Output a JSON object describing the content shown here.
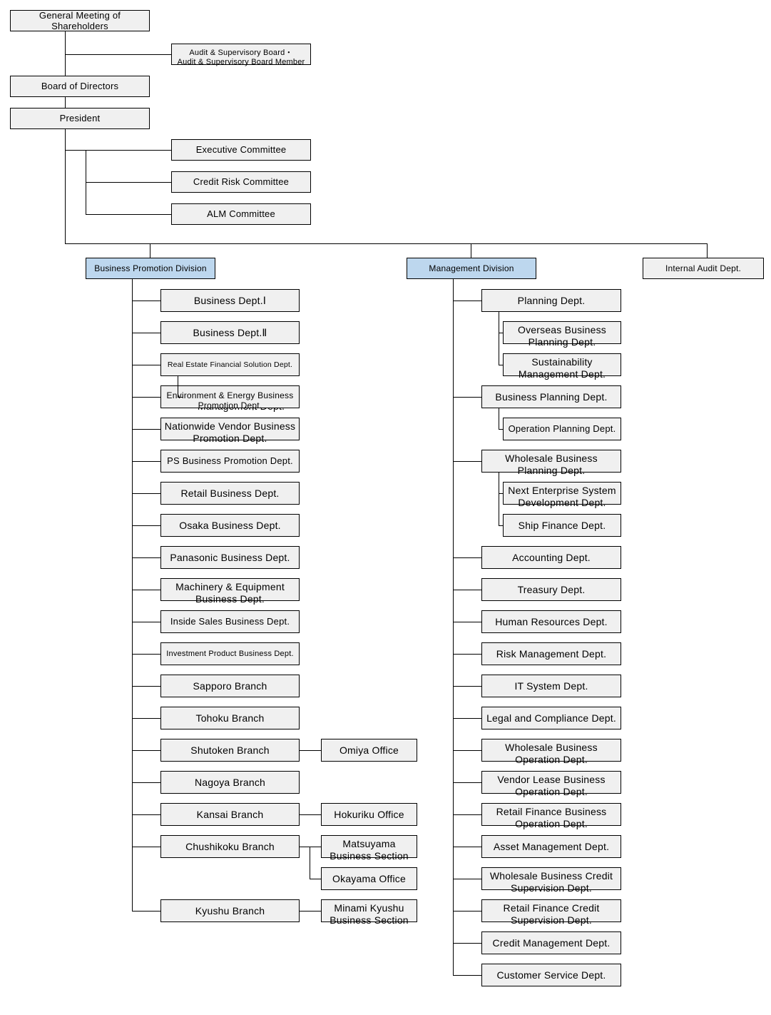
{
  "title": "Organization Chart",
  "colors": {
    "division_fill": "#bdd7ee",
    "box_fill": "#f0f0f0",
    "line": "#000000",
    "text": "#000000"
  },
  "top": {
    "shareholders": "General Meeting of Shareholders",
    "audit_board": "Audit & Supervisory Board・\nAudit & Supervisory Board Member",
    "board_of_directors": "Board of Directors",
    "president": "President"
  },
  "committees": [
    {
      "label": "Executive Committee"
    },
    {
      "label": "Credit Risk Committee"
    },
    {
      "label": "ALM Committee"
    }
  ],
  "divisions": {
    "business_promotion": "Business Promotion Division",
    "management": "Management Division",
    "internal_audit": "Internal  Audit  Dept."
  },
  "business_promotion_units": [
    {
      "label": "Business Dept.Ⅰ",
      "lines": 1,
      "children": []
    },
    {
      "label": "Business Dept.Ⅱ",
      "lines": 1,
      "children": []
    },
    {
      "label": "Real Estate Financial Solution Dept.",
      "lines": 1,
      "children": [
        {
          "label": "Real Estate Asset\nManagement Dept.",
          "lines": 2
        }
      ]
    },
    {
      "label": "Environment & Energy Business\nPromotion Dept.",
      "lines": 2,
      "children": []
    },
    {
      "label": "Nationwide Vendor Business\nPromotion Dept.",
      "lines": 2,
      "children": []
    },
    {
      "label": "PS Business Promotion Dept.",
      "lines": 1,
      "children": []
    },
    {
      "label": "Retail Business Dept.",
      "lines": 1,
      "children": []
    },
    {
      "label": "Osaka Business Dept.",
      "lines": 1,
      "children": []
    },
    {
      "label": "Panasonic Business Dept.",
      "lines": 1,
      "children": []
    },
    {
      "label": "Machinery & Equipment\nBusiness Dept.",
      "lines": 2,
      "children": []
    },
    {
      "label": "Inside Sales Business Dept.",
      "lines": 1,
      "children": []
    },
    {
      "label": "Investment Product Business Dept.",
      "lines": 1,
      "children": []
    },
    {
      "label": "Sapporo Branch",
      "lines": 1,
      "children": []
    },
    {
      "label": "Tohoku Branch",
      "lines": 1,
      "children": []
    },
    {
      "label": "Shutoken Branch",
      "lines": 1,
      "children": [
        {
          "label": "Omiya Office",
          "lines": 1
        }
      ]
    },
    {
      "label": "Nagoya Branch",
      "lines": 1,
      "children": []
    },
    {
      "label": "Kansai Branch",
      "lines": 1,
      "children": [
        {
          "label": "Hokuriku Office",
          "lines": 1
        }
      ]
    },
    {
      "label": "Chushikoku Branch",
      "lines": 1,
      "children": [
        {
          "label": "Matsuyama\nBusiness Section",
          "lines": 2
        },
        {
          "label": "Okayama Office",
          "lines": 1
        }
      ]
    },
    {
      "label": "Kyushu Branch",
      "lines": 1,
      "children": [
        {
          "label": "Minami Kyushu\nBusiness Section",
          "lines": 2
        }
      ]
    }
  ],
  "management_units": [
    {
      "label": "Planning Dept.",
      "lines": 1,
      "children": [
        {
          "label": "Overseas Business\nPlanning Dept.",
          "lines": 2
        },
        {
          "label": "Sustainability\nManagement Dept.",
          "lines": 2
        }
      ]
    },
    {
      "label": "Business Planning Dept.",
      "lines": 1,
      "children": [
        {
          "label": "Operation Planning Dept.",
          "lines": 1
        }
      ]
    },
    {
      "label": "Wholesale Business\nPlanning Dept.",
      "lines": 2,
      "children": [
        {
          "label": "Next Enterprise System\nDevelopment Dept.",
          "lines": 2
        },
        {
          "label": "Ship Finance Dept.",
          "lines": 1
        }
      ]
    },
    {
      "label": "Accounting Dept.",
      "lines": 1,
      "children": []
    },
    {
      "label": "Treasury Dept.",
      "lines": 1,
      "children": []
    },
    {
      "label": "Human Resources Dept.",
      "lines": 1,
      "children": []
    },
    {
      "label": "Risk Management Dept.",
      "lines": 1,
      "children": []
    },
    {
      "label": "IT System Dept.",
      "lines": 1,
      "children": []
    },
    {
      "label": "Legal and Compliance Dept.",
      "lines": 1,
      "children": []
    },
    {
      "label": "Wholesale Business\nOperation Dept.",
      "lines": 2,
      "children": []
    },
    {
      "label": "Vendor Lease Business\nOperation Dept.",
      "lines": 2,
      "children": []
    },
    {
      "label": "Retail Finance Business\nOperation Dept.",
      "lines": 2,
      "children": []
    },
    {
      "label": "Asset Management Dept.",
      "lines": 1,
      "children": []
    },
    {
      "label": "Wholesale Business Credit\nSupervision Dept.",
      "lines": 2,
      "children": []
    },
    {
      "label": "Retail Finance Credit\nSupervision Dept.",
      "lines": 2,
      "children": []
    },
    {
      "label": "Credit Management Dept.",
      "lines": 1,
      "children": []
    },
    {
      "label": "Customer Service Dept.",
      "lines": 1,
      "children": []
    }
  ]
}
